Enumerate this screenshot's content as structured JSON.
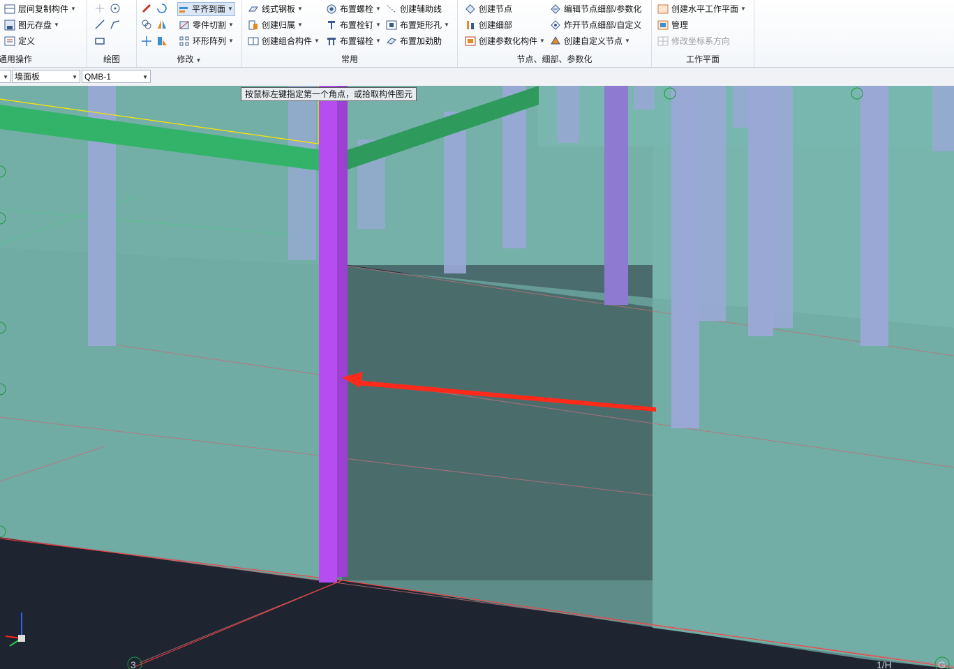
{
  "ribbon": {
    "general": {
      "items": [
        "层间复制构件",
        "图元存盘",
        "定义"
      ],
      "label": "通用操作"
    },
    "draw": {
      "label": "绘图"
    },
    "modify": {
      "items": [
        "平齐到面",
        "零件切割",
        "环形阵列"
      ],
      "label": "修改"
    },
    "common": {
      "col1": [
        "线式钢板",
        "创建归属",
        "创建组合构件"
      ],
      "col2": [
        "布置螺栓",
        "布置栓钉",
        "布置锚栓"
      ],
      "col3": [
        "创建辅助线",
        "布置矩形孔",
        "布置加劲肋"
      ],
      "label": "常用"
    },
    "nodes": {
      "col1": [
        "创建节点",
        "创建细部",
        "创建参数化构件"
      ],
      "col2": [
        "编辑节点细部/参数化",
        "炸开节点细部/自定义",
        "创建自定义节点"
      ],
      "label": "节点、细部、参数化"
    },
    "workplane": {
      "items": [
        "创建水平工作平面",
        "管理",
        "修改坐标系方向"
      ],
      "label": "工作平面"
    }
  },
  "fieldbar": {
    "category": "墙面板",
    "component": "QMB-1"
  },
  "viewport": {
    "tooltip": "按鼠标左键指定第一个角点，或拾取构件图元",
    "grid_labels": {
      "g3": "3",
      "g1h": "1/H",
      "gG": "G"
    }
  },
  "colors": {
    "background": "#1f2530",
    "slab": "#7fbdb3",
    "column": "#9aa8d6",
    "selected_column": "#b64df0",
    "beam": "#33b36a",
    "arrow": "#ff2a1a"
  }
}
